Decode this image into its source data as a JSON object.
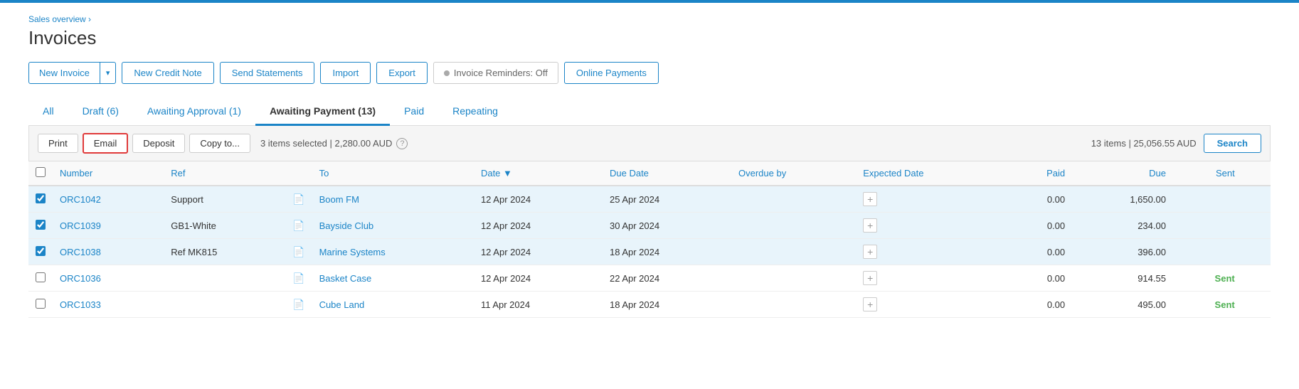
{
  "topbar": {
    "color": "#1b84c7"
  },
  "breadcrumb": {
    "label": "Sales overview ›"
  },
  "page": {
    "title": "Invoices"
  },
  "toolbar": {
    "new_invoice_label": "New Invoice",
    "new_credit_note_label": "New Credit Note",
    "send_statements_label": "Send Statements",
    "import_label": "Import",
    "export_label": "Export",
    "reminders_label": "Invoice Reminders: Off",
    "online_payments_label": "Online Payments"
  },
  "tabs": [
    {
      "id": "all",
      "label": "All",
      "active": false
    },
    {
      "id": "draft",
      "label": "Draft (6)",
      "active": false
    },
    {
      "id": "awaiting-approval",
      "label": "Awaiting Approval (1)",
      "active": false
    },
    {
      "id": "awaiting-payment",
      "label": "Awaiting Payment (13)",
      "active": true
    },
    {
      "id": "paid",
      "label": "Paid",
      "active": false
    },
    {
      "id": "repeating",
      "label": "Repeating",
      "active": false
    }
  ],
  "actionbar": {
    "print_label": "Print",
    "email_label": "Email",
    "deposit_label": "Deposit",
    "copy_to_label": "Copy to...",
    "selected_info": "3 items selected | 2,280.00 AUD",
    "total_info": "13 items  | 25,056.55 AUD",
    "search_label": "Search"
  },
  "table": {
    "columns": [
      {
        "id": "number",
        "label": "Number"
      },
      {
        "id": "ref",
        "label": "Ref"
      },
      {
        "id": "icon",
        "label": ""
      },
      {
        "id": "to",
        "label": "To"
      },
      {
        "id": "date",
        "label": "Date ▼"
      },
      {
        "id": "due-date",
        "label": "Due Date"
      },
      {
        "id": "overdue-by",
        "label": "Overdue by"
      },
      {
        "id": "expected-date",
        "label": "Expected Date"
      },
      {
        "id": "paid",
        "label": "Paid"
      },
      {
        "id": "due",
        "label": "Due"
      },
      {
        "id": "sent",
        "label": "Sent"
      },
      {
        "id": "action",
        "label": ""
      }
    ],
    "rows": [
      {
        "checked": true,
        "number": "ORC1042",
        "ref": "Support",
        "to": "Boom FM",
        "date": "12 Apr 2024",
        "due_date": "25 Apr 2024",
        "overdue_by": "",
        "expected_date": "",
        "paid": "0.00",
        "due": "1,650.00",
        "sent": "",
        "selected": true
      },
      {
        "checked": true,
        "number": "ORC1039",
        "ref": "GB1-White",
        "to": "Bayside Club",
        "date": "12 Apr 2024",
        "due_date": "30 Apr 2024",
        "overdue_by": "",
        "expected_date": "",
        "paid": "0.00",
        "due": "234.00",
        "sent": "",
        "selected": true
      },
      {
        "checked": true,
        "number": "ORC1038",
        "ref": "Ref MK815",
        "to": "Marine Systems",
        "date": "12 Apr 2024",
        "due_date": "18 Apr 2024",
        "overdue_by": "",
        "expected_date": "",
        "paid": "0.00",
        "due": "396.00",
        "sent": "",
        "selected": true
      },
      {
        "checked": false,
        "number": "ORC1036",
        "ref": "",
        "to": "Basket Case",
        "date": "12 Apr 2024",
        "due_date": "22 Apr 2024",
        "overdue_by": "",
        "expected_date": "",
        "paid": "0.00",
        "due": "914.55",
        "sent": "Sent",
        "selected": false
      },
      {
        "checked": false,
        "number": "ORC1033",
        "ref": "",
        "to": "Cube Land",
        "date": "11 Apr 2024",
        "due_date": "18 Apr 2024",
        "overdue_by": "",
        "expected_date": "",
        "paid": "0.00",
        "due": "495.00",
        "sent": "Sent",
        "selected": false
      }
    ]
  }
}
